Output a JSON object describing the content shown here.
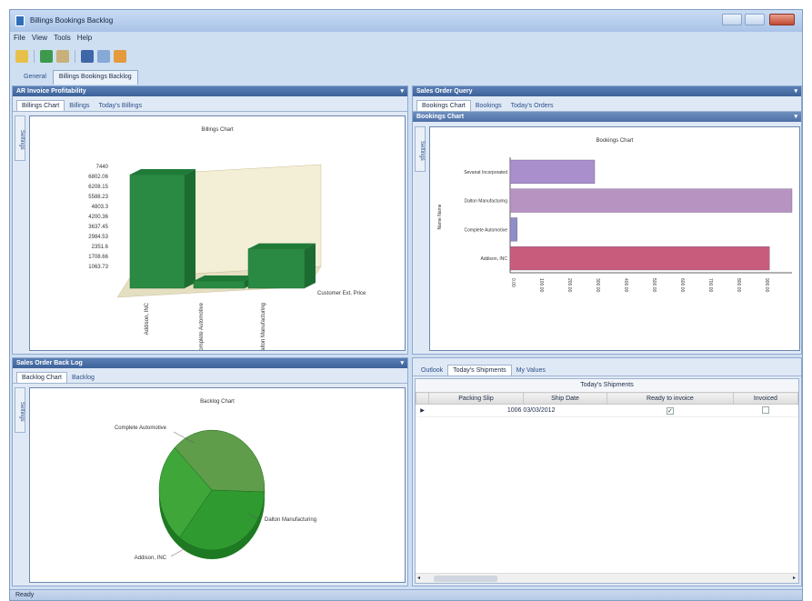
{
  "window": {
    "title": "Billings Bookings Backlog"
  },
  "menu": [
    "File",
    "View",
    "Tools",
    "Help"
  ],
  "toolbar_icons": [
    "open-folder-icon",
    "export-excel-icon",
    "edit-icon",
    "save-icon",
    "print-preview-icon",
    "email-icon"
  ],
  "doc_tabs": [
    "General",
    "Billings Bookings Backlog"
  ],
  "ar_panel": {
    "title": "AR Invoice Profitability",
    "tabs": [
      "Billings Chart",
      "Billings",
      "Today's Billings"
    ],
    "side_tab": "Settings",
    "chart_title": "Billings Chart"
  },
  "sales_panel": {
    "title": "Sales Order Query",
    "tabs": [
      "Bookings Chart",
      "Bookings",
      "Today's Orders"
    ],
    "sub_title": "Bookings Chart",
    "side_tab": "Settings",
    "chart_title": "Bookings Chart"
  },
  "backlog_panel": {
    "title": "Sales Order Back Log",
    "tabs": [
      "Backlog Chart",
      "Backlog"
    ],
    "side_tab": "Settings",
    "chart_title": "Backlog Chart"
  },
  "shipments_panel": {
    "tabs": [
      "Outlook",
      "Today's Shipments",
      "My Values"
    ],
    "grid_title": "Today's Shipments",
    "columns": [
      "Packing Slip",
      "Ship Date",
      "Ready to invoice",
      "Invoiced"
    ],
    "rows": [
      {
        "packing_slip": "1006",
        "ship_date": "03/03/2012",
        "ready": true,
        "invoiced": false
      }
    ]
  },
  "status": "Ready",
  "colors": {
    "bar_green": "#2e8b46",
    "bar_purple_light": "#a98fcc",
    "bar_pink": "#c85c7c",
    "pie_green": "#3aa53a"
  },
  "chart_data": [
    {
      "type": "bar",
      "title": "Billings Chart",
      "categories": [
        "Addison, INC",
        "Complete Automotive",
        "Dalton Manufacturing"
      ],
      "values": [
        7440,
        650,
        3000
      ],
      "ylim": [
        1063.73,
        7440
      ],
      "y_ticks": [
        "7440",
        "6802.06",
        "6208.15",
        "5588.23",
        "4803.3",
        "4200.36",
        "3637.45",
        "2984.53",
        "2351.6",
        "1708.66",
        "1063.73"
      ],
      "xlabel": "Customer Ext. Price",
      "three_d": true
    },
    {
      "type": "bar",
      "orientation": "horizontal",
      "title": "Bookings Chart",
      "categories": [
        "Sevanat Incorporated",
        "Dalton Manufacturing",
        "Complete Automotive",
        "Addison, INC"
      ],
      "values": [
        300,
        1000,
        25,
        920
      ],
      "xlim": [
        0,
        1000
      ],
      "x_ticks": [
        "0.00",
        "100.00",
        "200.00",
        "300.00",
        "400.00",
        "500.00",
        "600.00",
        "700.00",
        "800.00",
        "900.00"
      ],
      "ylabel": "Name Name",
      "bar_colors": [
        "#a98fcc",
        "#b793c1",
        "#8e8ec8",
        "#c85c7c"
      ]
    },
    {
      "type": "pie",
      "title": "Backlog Chart",
      "labels": [
        "Complete Automotive",
        "Dalton Manufacturing",
        "Addison, INC"
      ],
      "values": [
        38,
        35,
        27
      ],
      "three_d": true
    }
  ]
}
